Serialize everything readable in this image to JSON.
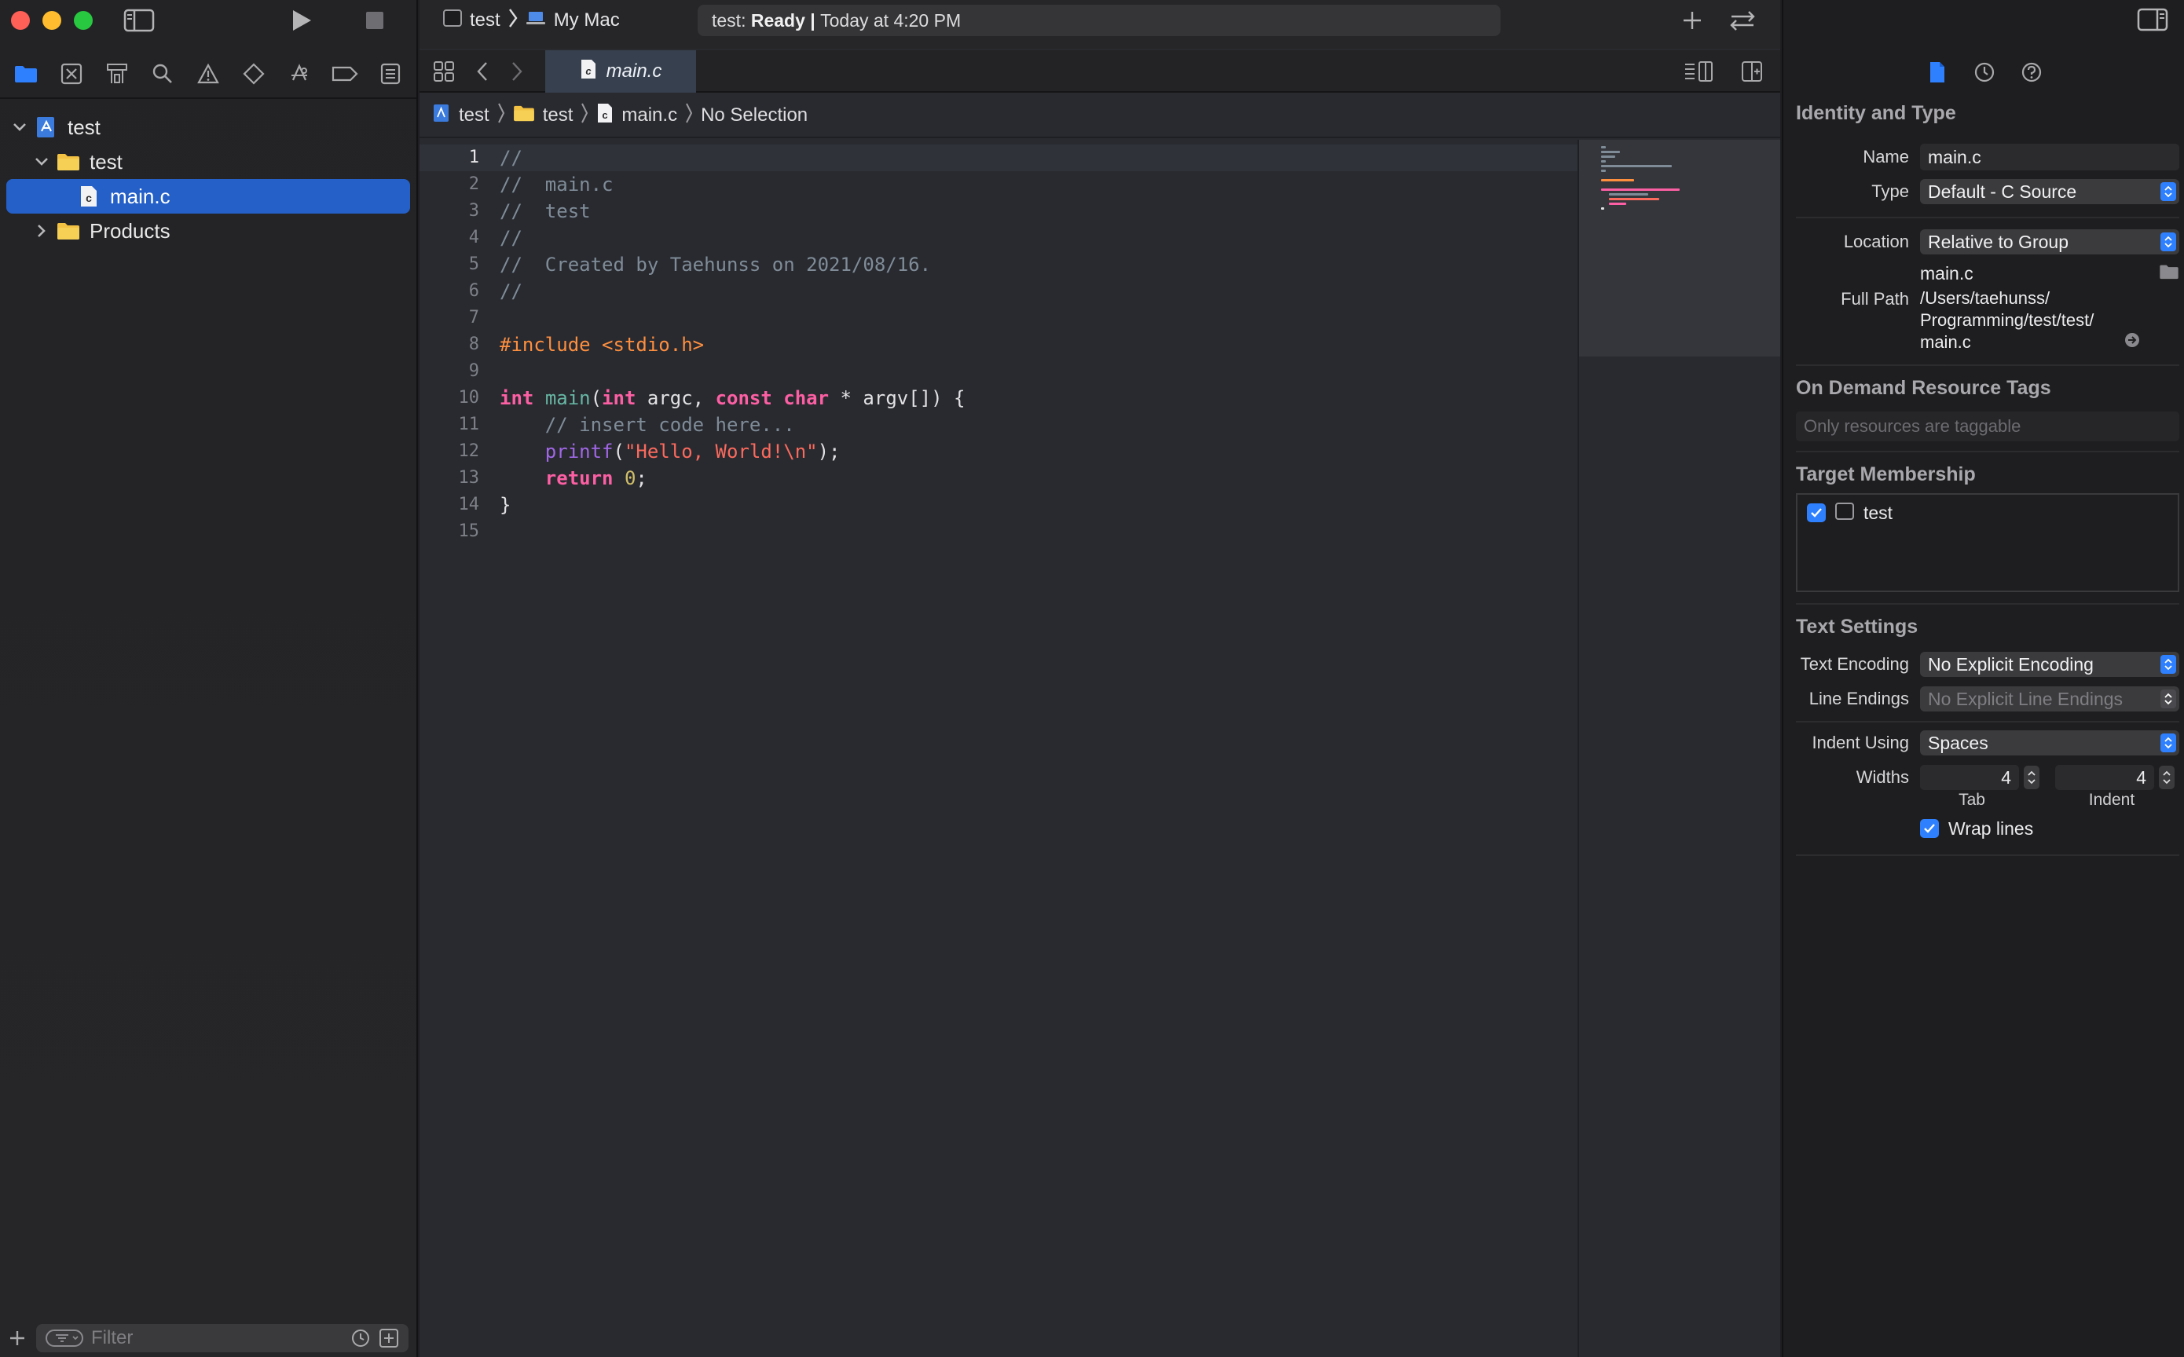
{
  "toolbar": {
    "scheme": "test",
    "destination": "My Mac",
    "activity_prefix": "test:",
    "activity_status": "Ready",
    "activity_sep": "|",
    "activity_time": "Today at 4:20 PM"
  },
  "navigator": {
    "tree": [
      {
        "label": "test",
        "level": 0,
        "icon": "project-icon",
        "expanded": true
      },
      {
        "label": "test",
        "level": 1,
        "icon": "folder-icon",
        "expanded": true
      },
      {
        "label": "main.c",
        "level": 2,
        "icon": "c-file-icon",
        "selected": true
      },
      {
        "label": "Products",
        "level": 1,
        "icon": "folder-icon",
        "expanded": false
      }
    ],
    "filter_placeholder": "Filter"
  },
  "editor": {
    "tab_label": "main.c",
    "jumpbar": [
      "test",
      "test",
      "main.c",
      "No Selection"
    ],
    "current_line": 1,
    "lines": [
      "//",
      "//  main.c",
      "//  test",
      "//",
      "//  Created by Taehunss on 2021/08/16.",
      "//",
      "",
      "#include <stdio.h>",
      "",
      "int main(int argc, const char * argv[]) {",
      "    // insert code here...",
      "    printf(\"Hello, World!\\n\");",
      "    return 0;",
      "}",
      ""
    ]
  },
  "inspector": {
    "identity_header": "Identity and Type",
    "name_label": "Name",
    "name_value": "main.c",
    "type_label": "Type",
    "type_value": "Default - C Source",
    "location_label": "Location",
    "location_value": "Relative to Group",
    "location_file": "main.c",
    "fullpath_label": "Full Path",
    "fullpath_lines": [
      "/Users/taehunss/",
      "Programming/test/test/",
      "main.c"
    ],
    "odr_header": "On Demand Resource Tags",
    "odr_placeholder": "Only resources are taggable",
    "membership_header": "Target Membership",
    "membership_target": "test",
    "text_header": "Text Settings",
    "encoding_label": "Text Encoding",
    "encoding_value": "No Explicit Encoding",
    "endings_label": "Line Endings",
    "endings_value": "No Explicit Line Endings",
    "indent_label": "Indent Using",
    "indent_value": "Spaces",
    "widths_label": "Widths",
    "tab_width": "4",
    "indent_width": "4",
    "tab_sublabel": "Tab",
    "indent_sublabel": "Indent",
    "wrap_label": "Wrap lines"
  },
  "colors": {
    "accent": "#2f80ff",
    "selection": "#2460c8",
    "keyword": "#fc5fa3",
    "comment": "#7f8c98",
    "preprocessor": "#fd8f3f",
    "string": "#fc6a5d",
    "number": "#d0bf69"
  }
}
